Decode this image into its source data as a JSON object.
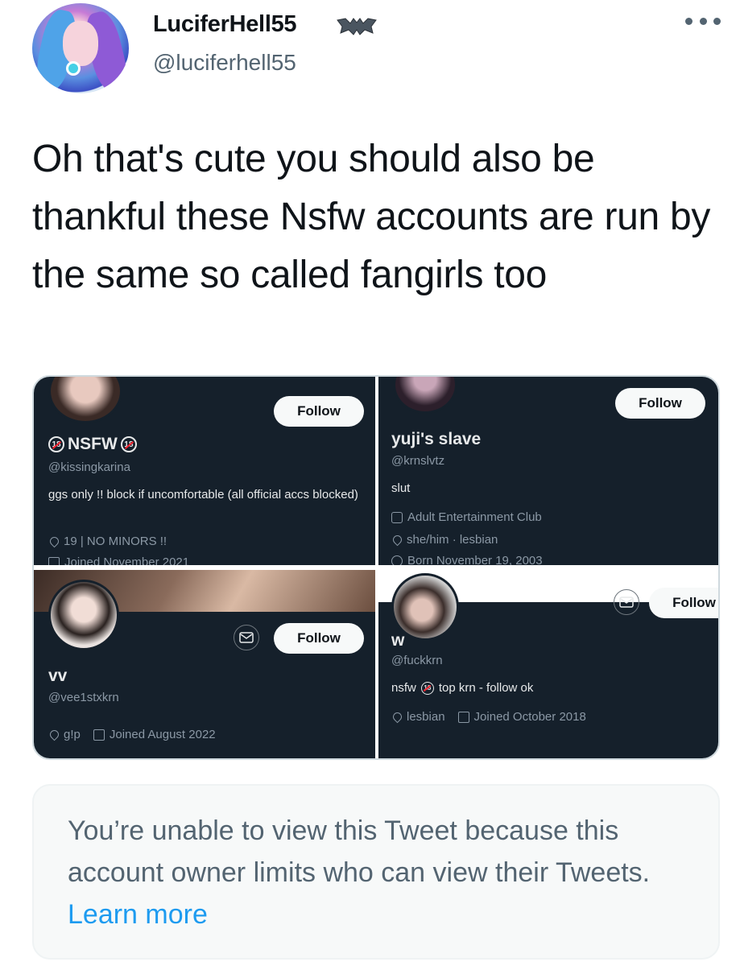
{
  "tweet": {
    "author": {
      "display_name": "LuciferHell55",
      "handle": "@luciferhell55",
      "badge_icon": "bat-icon"
    },
    "text": "Oh that's cute you should also be thankful these Nsfw accounts are run by the same so called fangirls too",
    "more_icon": "more-icon"
  },
  "media": {
    "panels": [
      {
        "name": "NSFW",
        "handle": "@kissingkarina",
        "bio": "ggs only !! block if uncomfortable (all official accs blocked)",
        "location": "19 | NO MINORS !!",
        "joined": "Joined November 2021",
        "follow_label": "Follow"
      },
      {
        "name": "yuji's slave",
        "handle": "@krnslvtz",
        "bio": "slut",
        "category": "Adult Entertainment Club",
        "location": "she/him · lesbian",
        "birth": "Born November 19, 2003",
        "follow_label": "Follow"
      },
      {
        "name": "vv",
        "handle": "@vee1stxkrn",
        "location": "g!p",
        "joined": "Joined August 2022",
        "follow_label": "Follow"
      },
      {
        "name": "w",
        "handle": "@fuckkrn",
        "bio_prefix": "nsfw",
        "bio_suffix": "top krn - follow ok",
        "location": "lesbian",
        "joined": "Joined October 2018",
        "follow_label": "Follow"
      }
    ],
    "badge_text": "18",
    "colors": {
      "panel_bg": "#15202b",
      "secondary_text": "#8b98a5"
    }
  },
  "notice": {
    "text": "You’re unable to view this Tweet because this account owner limits who can view their Tweets.",
    "link": "Learn more",
    "link_color": "#1d9bf0"
  }
}
